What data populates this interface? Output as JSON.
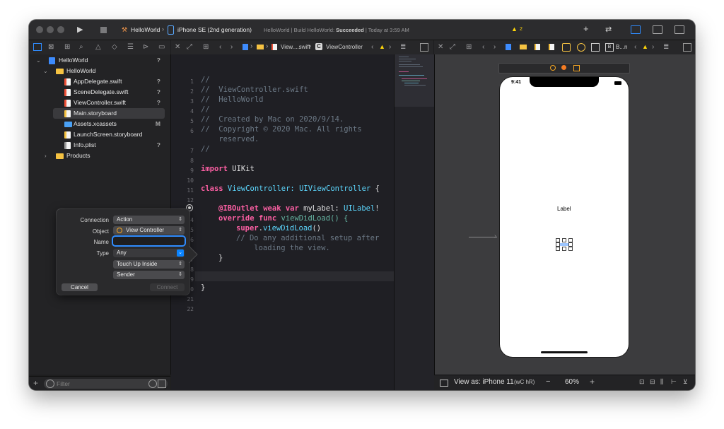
{
  "titlebar": {
    "scheme": "HelloWorld",
    "device": "iPhone SE (2nd generation)",
    "status_project": "HelloWorld | Build HelloWorld:",
    "status_result": "Succeeded",
    "status_time": "| Today at 3:59 AM",
    "warnings": "2"
  },
  "navigator": {
    "items": [
      {
        "label": "HelloWorld",
        "status": "?"
      },
      {
        "label": "HelloWorld",
        "status": ""
      },
      {
        "label": "AppDelegate.swift",
        "status": "?"
      },
      {
        "label": "SceneDelegate.swift",
        "status": "?"
      },
      {
        "label": "ViewController.swift",
        "status": "?"
      },
      {
        "label": "Main.storyboard",
        "status": ""
      },
      {
        "label": "Assets.xcassets",
        "status": "M"
      },
      {
        "label": "LaunchScreen.storyboard",
        "status": ""
      },
      {
        "label": "Info.plist",
        "status": "?"
      },
      {
        "label": "Products",
        "status": ""
      }
    ],
    "filter_placeholder": "Filter"
  },
  "editor": {
    "jumpbar_file": "View....swift",
    "jumpbar_symbol": "ViewController",
    "lines": {
      "l1": "//",
      "l2": "//  ViewController.swift",
      "l3": "//  HelloWorld",
      "l4": "//",
      "l5": "//  Created by Mac on 2020/9/14.",
      "l6a": "//  Copyright © 2020 Mac. All rights",
      "l6b": "    reserved.",
      "l7": "//",
      "l9a": "import",
      "l9b": " UIKit",
      "l11a": "class",
      "l11b": " ViewController: ",
      "l11c": "UIViewController",
      "l11d": " {",
      "l13a": "@IBOutlet",
      "l13b": " weak",
      "l13c": " var",
      "l13d": " myLabel: ",
      "l13e": "UILabel",
      "l13f": "!",
      "l14a": "override",
      "l14b": " func",
      "l14c": " viewDidLoad() {",
      "l15a": "super",
      "l15b": ".",
      "l15c": "viewDidLoad",
      "l15d": "()",
      "l16a": "// Do any additional setup after",
      "l16b": "    loading the view.",
      "l17": "}",
      "l20": "}"
    },
    "line_numbers": [
      "1",
      "2",
      "3",
      "4",
      "5",
      "6",
      "7",
      "8",
      "9",
      "10",
      "11",
      "12",
      "13",
      "14",
      "15",
      "16",
      "17",
      "18",
      "19",
      "20",
      "21",
      "22"
    ]
  },
  "canvas": {
    "jumpbar_item": "B...n",
    "time": "9:41",
    "label_text": "Label"
  },
  "canvas_bottom": {
    "view_as": "View as: iPhone 11",
    "size_class": "(wC hR)",
    "zoom": "60%"
  },
  "popover": {
    "connection_label": "Connection",
    "connection_value": "Action",
    "object_label": "Object",
    "object_value": "View Controller",
    "name_label": "Name",
    "name_value": "",
    "type_label": "Type",
    "type_value": "Any",
    "event_value": "Touch Up Inside",
    "arguments_value": "Sender",
    "cancel_label": "Cancel",
    "connect_label": "Connect"
  },
  "colors": {
    "accent": "#0a84ff",
    "comment": "#6c7986",
    "keyword": "#fc5fa3",
    "type": "#5dd8ff",
    "function": "#67b7a4",
    "warning": "#ffd60a"
  }
}
